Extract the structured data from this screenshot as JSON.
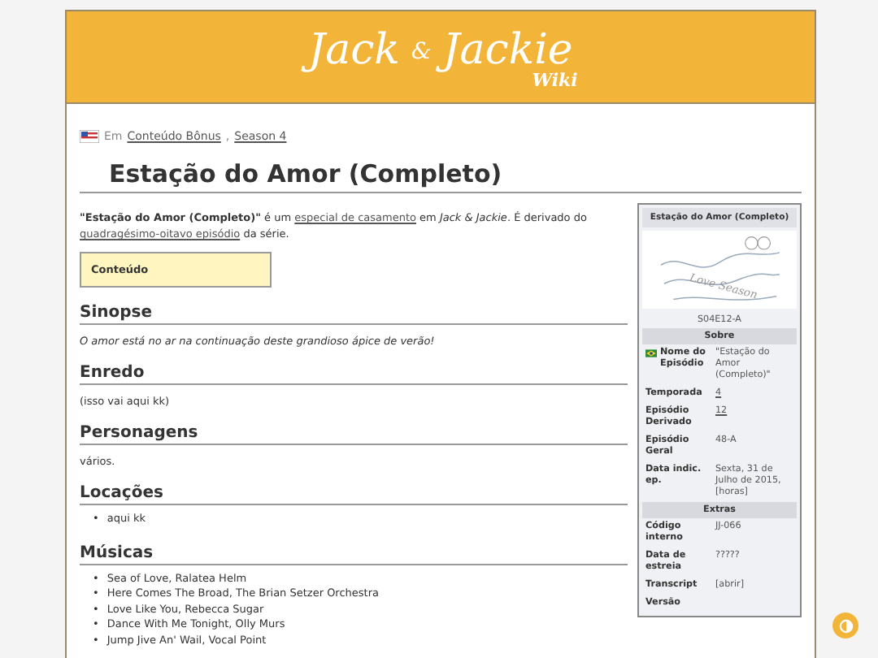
{
  "logo": {
    "title": "Jack",
    "amp": "&",
    "title2": "Jackie",
    "sub": "Wiki"
  },
  "breadcrumb": [
    {
      "kind": "text",
      "text": "Em"
    },
    {
      "kind": "link",
      "text": "Conteúdo Bônus"
    },
    {
      "kind": "text",
      "text": ","
    },
    {
      "kind": "link",
      "text": "Season 4"
    }
  ],
  "page_title": "Estação do Amor (Completo)",
  "intro": [
    {
      "kind": "bold",
      "text": "\"Estação do Amor (Completo)\""
    },
    {
      "kind": "text",
      "text": " é um "
    },
    {
      "kind": "link",
      "text": "especial de casamento"
    },
    {
      "kind": "text",
      "text": " em "
    },
    {
      "kind": "italic",
      "text": "Jack & Jackie"
    },
    {
      "kind": "text",
      "text": ". É derivado do "
    },
    {
      "kind": "link",
      "text": "quadragésimo-oitavo episódio"
    },
    {
      "kind": "text",
      "text": " da série."
    }
  ],
  "toc": {
    "title": "Conteúdo"
  },
  "sections": [
    {
      "heading": "Sinopse",
      "kind": "italic",
      "text": "O amor está no ar na continuação deste grandioso ápice de verão!"
    },
    {
      "heading": "Enredo",
      "kind": "paragraph",
      "text": "(isso vai aqui kk)"
    },
    {
      "heading": "Personagens",
      "kind": "paragraph",
      "text": "vários."
    },
    {
      "heading": "Locações",
      "kind": "list",
      "marker": "•",
      "items": [
        "aqui kk"
      ]
    },
    {
      "heading": "Músicas",
      "kind": "list",
      "marker": "•",
      "items": [
        "Sea of Love, Ralatea Helm",
        "Here Comes The Broad, The Brian Setzer Orchestra",
        "Love Like You, Rebecca Sugar",
        "Dance With Me Tonight, Olly Murs",
        "Jump Jive An' Wail, Vocal Point"
      ]
    }
  ],
  "infobox": {
    "title": "Estação do Amor (Completo)",
    "caption": "S04E12-A",
    "image_text": "Love Season",
    "groups": [
      {
        "heading": "Sobre",
        "rows": [
          {
            "label": "Nome do Episódio",
            "value": "\"Estação do Amor (Completo)\"",
            "kind": "flag"
          },
          {
            "label": "Temporada",
            "value": "4",
            "kind": "link"
          },
          {
            "label": "Episódio Derivado",
            "value": "12",
            "kind": "link"
          },
          {
            "label": "Episódio Geral",
            "value": "48-A",
            "kind": "text"
          },
          {
            "label": "Data indic. ep.",
            "value": "Sexta, 31 de Julho de 2015, [horas]",
            "kind": "text"
          }
        ]
      },
      {
        "heading": "Extras",
        "rows": [
          {
            "label": "Código interno",
            "value": "JJ-066",
            "kind": "text"
          },
          {
            "label": "Data de estreia",
            "value": "?????",
            "kind": "text"
          },
          {
            "label": "Transcript",
            "value": "[abrir]",
            "kind": "text"
          },
          {
            "label": "Versão",
            "kind": "text"
          }
        ]
      }
    ]
  }
}
